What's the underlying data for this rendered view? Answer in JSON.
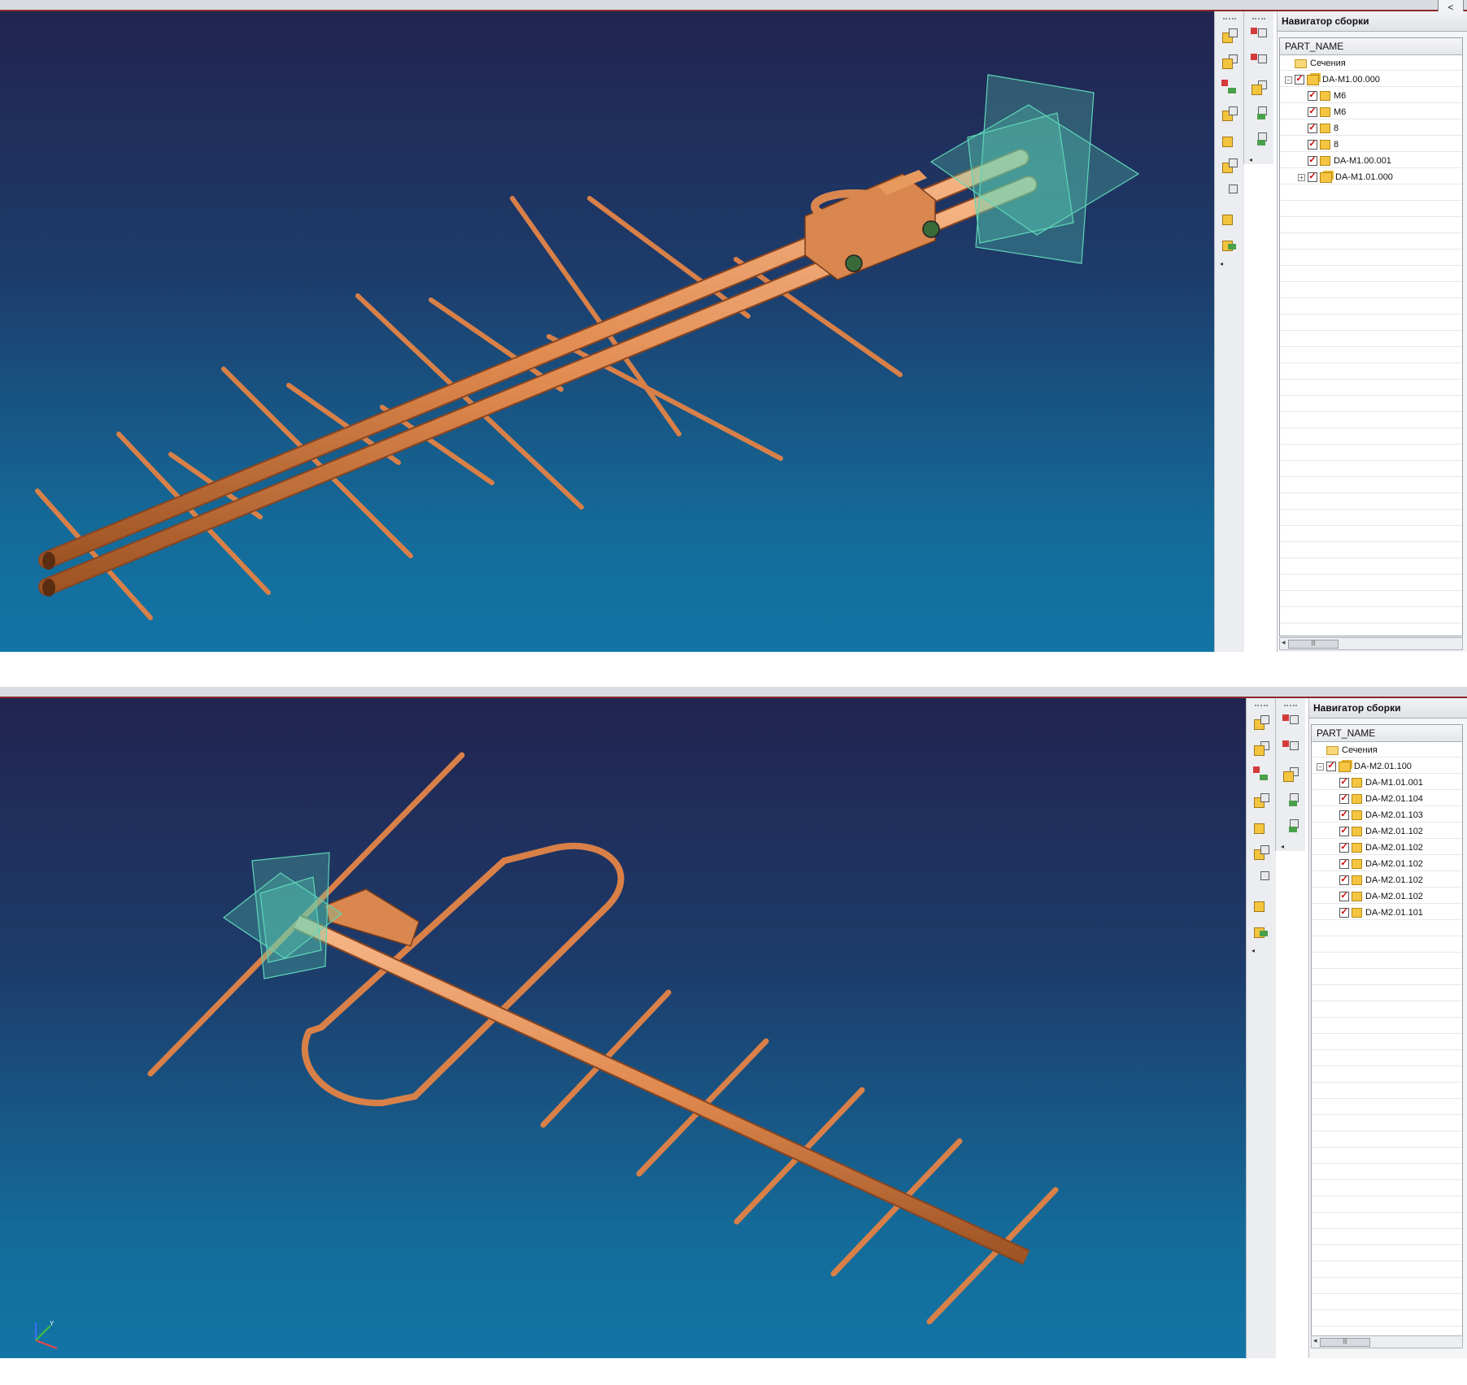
{
  "colors": {
    "copper": "#e08a4f",
    "viewport_top": "#222450",
    "viewport_bottom": "#1275a6",
    "datum_plane": "#5fd6b8"
  },
  "icons": [
    "add-component-icon",
    "mate-icon",
    "reposition-icon",
    "pattern-icon",
    "explode-icon",
    "link-icon",
    "wave-link-icon",
    "check-clearance-icon"
  ],
  "screens": [
    {
      "navigator": {
        "title": "Навигатор сборки",
        "column_header": "PART_NAME",
        "rows": [
          {
            "label": "Сечения",
            "type": "folder",
            "level": 1,
            "checked": false
          },
          {
            "label": "DA-M1.00.000",
            "type": "assembly",
            "level": 1,
            "checked": true,
            "expander": "⊖"
          },
          {
            "label": "M6",
            "type": "part",
            "level": 2,
            "checked": true
          },
          {
            "label": "M6",
            "type": "part",
            "level": 2,
            "checked": true
          },
          {
            "label": "8",
            "type": "part",
            "level": 2,
            "checked": true
          },
          {
            "label": "8",
            "type": "part",
            "level": 2,
            "checked": true
          },
          {
            "label": "DA-M1.00.001",
            "type": "part",
            "level": 2,
            "checked": true
          },
          {
            "label": "DA-M1.01.000",
            "type": "assembly",
            "level": 2,
            "checked": true,
            "expander": "⊕"
          }
        ]
      }
    },
    {
      "navigator": {
        "title": "Навигатор сборки",
        "column_header": "PART_NAME",
        "rows": [
          {
            "label": "Сечения",
            "type": "folder",
            "level": 1,
            "checked": false
          },
          {
            "label": "DA-M2.01.100",
            "type": "assembly",
            "level": 1,
            "checked": true,
            "expander": "⊖"
          },
          {
            "label": "DA-M1.01.001",
            "type": "part",
            "level": 2,
            "checked": true
          },
          {
            "label": "DA-M2.01.104",
            "type": "part",
            "level": 2,
            "checked": true
          },
          {
            "label": "DA-M2.01.103",
            "type": "part",
            "level": 2,
            "checked": true
          },
          {
            "label": "DA-M2.01.102",
            "type": "part",
            "level": 2,
            "checked": true
          },
          {
            "label": "DA-M2.01.102",
            "type": "part",
            "level": 2,
            "checked": true
          },
          {
            "label": "DA-M2.01.102",
            "type": "part",
            "level": 2,
            "checked": true
          },
          {
            "label": "DA-M2.01.102",
            "type": "part",
            "level": 2,
            "checked": true
          },
          {
            "label": "DA-M2.01.102",
            "type": "part",
            "level": 2,
            "checked": true
          },
          {
            "label": "DA-M2.01.101",
            "type": "part",
            "level": 2,
            "checked": true
          }
        ]
      }
    }
  ],
  "triad": {
    "x_label": "X",
    "y_label": "Y",
    "z_label": "Z"
  }
}
